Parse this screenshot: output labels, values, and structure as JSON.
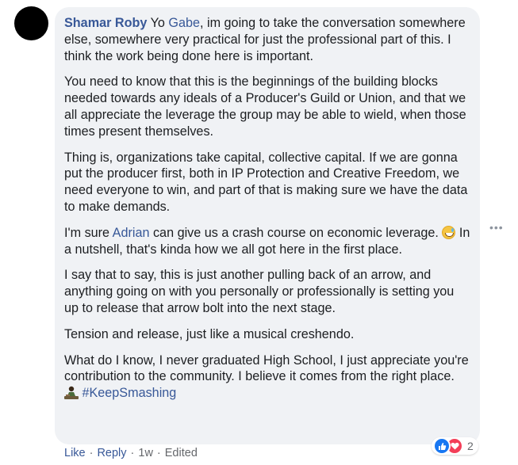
{
  "comment": {
    "author": "Shamar Roby",
    "p1_before_mention": " Yo ",
    "p1_mention": "Gabe",
    "p1_after_mention": ", im going to take the conversation somewhere else, somewhere very practical for just the professional part of this. I think the work being done here is important.",
    "p2": "You need to know that this is the beginnings of the building blocks needed towards any ideals of a Producer's Guild or Union, and that we all appreciate the leverage the group may be able to wield, when those times present themselves.",
    "p3": "Thing is, organizations take capital, collective capital. If we are gonna put the producer first, both in IP Protection and Creative Freedom, we need everyone to win, and part of that is making sure we have the data to make demands.",
    "p4_before_mention": "I'm sure ",
    "p4_mention": "Adrian",
    "p4_after_mention": " can give us a crash course on economic leverage. ",
    "p4_after_emoji": " In a nutshell, that's kinda how we all got here in the first place.",
    "p5": "I say that to say, this is just another pulling back of an arrow, and anything going on with you personally or professionally is setting you up to release that arrow bolt into the next stage.",
    "p6": "Tension and release, just like a musical creshendo.",
    "p7": "What do I know, I never graduated High School, I just appreciate you're contribution to the community. I believe it comes from the right place. ",
    "p7_hashtag": "#KeepSmashing",
    "emojis": [
      "grinning-sweat-emoji",
      "person-emoji"
    ]
  },
  "reactions": {
    "types": [
      "like",
      "love"
    ],
    "count": "2"
  },
  "actions": {
    "like": "Like",
    "reply": "Reply",
    "time": "1w",
    "edited": "Edited",
    "separator": "·"
  },
  "colors": {
    "bubble_bg": "#f0f2f5",
    "link": "#385898",
    "text": "#1c1e21",
    "meta": "#65676b",
    "like_blue": "#1877f2",
    "love_red": "#f33e58"
  }
}
